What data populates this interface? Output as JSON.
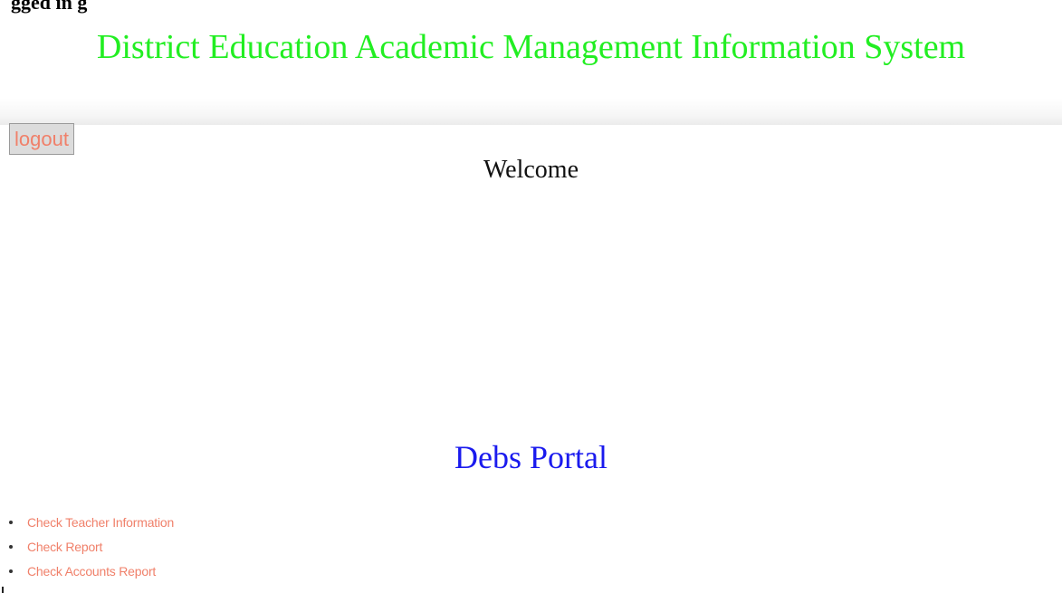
{
  "cut_text": "gged in g",
  "header": {
    "title": "District Education Academic Management Information System"
  },
  "logout_label": "logout",
  "welcome_text": "Welcome",
  "portal_title": "Debs Portal",
  "nav_links": [
    {
      "label": "Check Teacher Information"
    },
    {
      "label": "Check Report"
    },
    {
      "label": "Check Accounts Report"
    }
  ],
  "colors": {
    "title": "#22ee22",
    "link": "#f0806a",
    "portal_title": "#1a1aee"
  }
}
